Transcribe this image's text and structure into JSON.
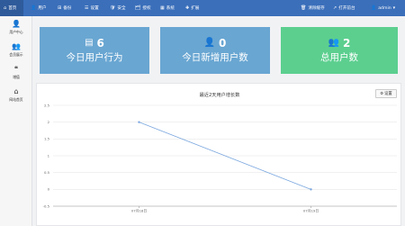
{
  "nav": {
    "items": [
      {
        "icon": "⌂",
        "label": "首页",
        "active": true
      },
      {
        "icon": "👤",
        "label": "用户"
      },
      {
        "icon": "⊞",
        "label": "备份"
      },
      {
        "icon": "☰",
        "label": "设置"
      },
      {
        "icon": "🛡",
        "label": "安全"
      },
      {
        "icon": "🗂",
        "label": "授权"
      },
      {
        "icon": "▦",
        "label": "系统"
      },
      {
        "icon": "✚",
        "label": "扩展"
      }
    ],
    "right": {
      "clear_cache": "清除缓存",
      "open_site": "打开前台",
      "user": "admin"
    }
  },
  "sidebar": {
    "items": [
      {
        "icon": "👤",
        "label": "用户中心"
      },
      {
        "icon": "👥",
        "label": "会员展示"
      },
      {
        "icon": "❝",
        "label": "增值"
      },
      {
        "icon": "⌂",
        "label": "网站首页"
      }
    ]
  },
  "cards": [
    {
      "icon": "▤",
      "value": "6",
      "label": "今日用户行为",
      "color": "#69a6d2"
    },
    {
      "icon": "👤",
      "value": "0",
      "label": "今日新增用户数",
      "color": "#69a6d2"
    },
    {
      "icon": "👥",
      "value": "2",
      "label": "总用户数",
      "color": "#5ccf8f"
    }
  ],
  "chart": {
    "settings_label": "设置"
  },
  "chart_data": {
    "type": "line",
    "title": "最近2天用户增长数",
    "categories": [
      "07月18日",
      "07月19日"
    ],
    "values": [
      2,
      0
    ],
    "ylim": [
      -0.5,
      2.5
    ],
    "yticks": [
      "2.5",
      "2",
      "1.5",
      "1",
      "0.5",
      "0",
      "-0.5"
    ],
    "grid": true,
    "line_color": "#7ba7df"
  }
}
